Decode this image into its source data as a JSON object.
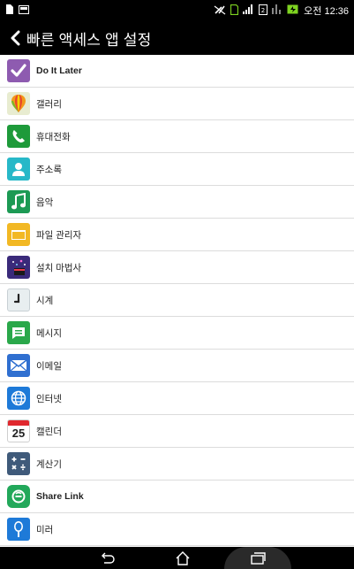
{
  "status_bar": {
    "time": "오전 12:36",
    "icons": [
      "notification-icon",
      "image-icon",
      "mute-icon",
      "sim-icon",
      "signal-icon",
      "data-icon",
      "signal-bars-icon",
      "battery-charging-icon"
    ]
  },
  "header": {
    "title": "빠른 액세스 앱 설정",
    "back_icon": "chevron-left-icon"
  },
  "apps": [
    {
      "label": "Do It Later",
      "bold": true,
      "icon": "check-icon",
      "color": "#8e5bb0"
    },
    {
      "label": "갤러리",
      "bold": false,
      "icon": "balloon-icon",
      "color": "#e8ecd0"
    },
    {
      "label": "휴대전화",
      "bold": false,
      "icon": "phone-icon",
      "color": "#1e9a3a"
    },
    {
      "label": "주소록",
      "bold": false,
      "icon": "contact-icon",
      "color": "#27b8c8"
    },
    {
      "label": "음악",
      "bold": false,
      "icon": "music-note-icon",
      "color": "#1c9a54"
    },
    {
      "label": "파일 관리자",
      "bold": false,
      "icon": "folder-icon",
      "color": "#f2b824"
    },
    {
      "label": "설치 마법사",
      "bold": false,
      "icon": "wizard-icon",
      "color": "#3a2a7a"
    },
    {
      "label": "시계",
      "bold": false,
      "icon": "clock-icon",
      "color": "#e8eef0"
    },
    {
      "label": "메시지",
      "bold": false,
      "icon": "message-icon",
      "color": "#2aa84a"
    },
    {
      "label": "이메일",
      "bold": false,
      "icon": "envelope-icon",
      "color": "#2f6fd0"
    },
    {
      "label": "인터넷",
      "bold": false,
      "icon": "globe-icon",
      "color": "#1e7ad8"
    },
    {
      "label": "캘린더",
      "bold": false,
      "icon": "calendar-icon",
      "color": "#ffffff",
      "number": "25"
    },
    {
      "label": "계산기",
      "bold": false,
      "icon": "calculator-icon",
      "color": "#3f5a7a"
    },
    {
      "label": "Share Link",
      "bold": true,
      "icon": "share-link-icon",
      "color": "#22a85a"
    },
    {
      "label": "미러",
      "bold": false,
      "icon": "mirror-icon",
      "color": "#1e7ad8"
    }
  ],
  "nav": {
    "back": "back-icon",
    "home": "home-icon",
    "recents": "recents-icon"
  }
}
